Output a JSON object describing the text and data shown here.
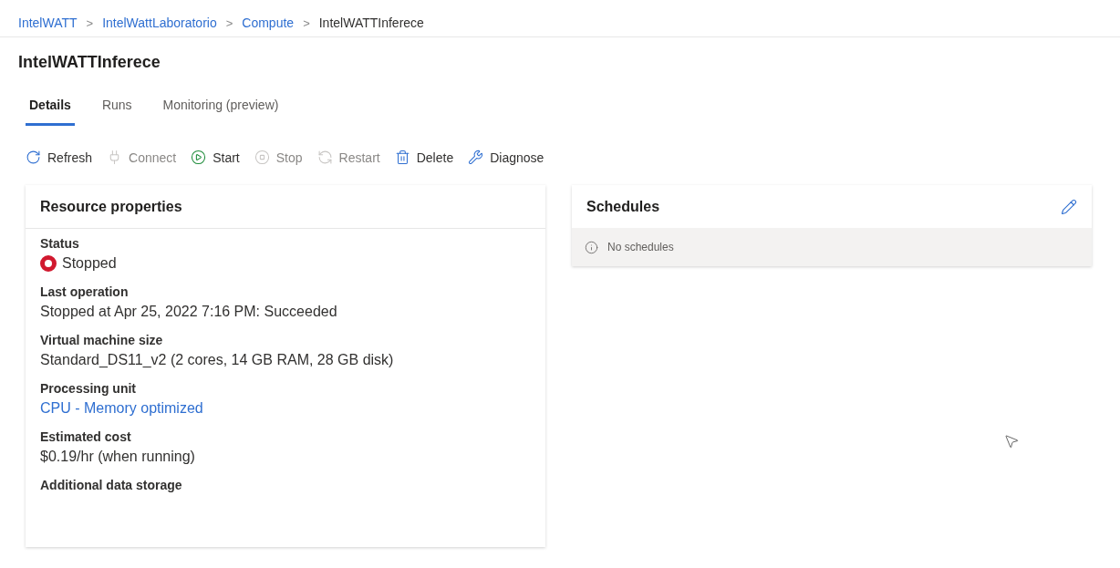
{
  "breadcrumb": [
    {
      "label": "IntelWATT",
      "link": true
    },
    {
      "label": "IntelWattLaboratorio",
      "link": true
    },
    {
      "label": "Compute",
      "link": true
    },
    {
      "label": "IntelWATTInferece",
      "link": false
    }
  ],
  "breadcrumb_separator": ">",
  "title": "IntelWATTInferece",
  "tabs": [
    {
      "label": "Details",
      "selected": true
    },
    {
      "label": "Runs",
      "selected": false
    },
    {
      "label": "Monitoring (preview)",
      "selected": false
    }
  ],
  "toolbar": [
    {
      "kind": "refresh",
      "label": "Refresh",
      "disabled": false
    },
    {
      "kind": "connect",
      "label": "Connect",
      "disabled": true
    },
    {
      "kind": "start",
      "label": "Start",
      "disabled": false
    },
    {
      "kind": "stop",
      "label": "Stop",
      "disabled": true
    },
    {
      "kind": "restart",
      "label": "Restart",
      "disabled": true
    },
    {
      "kind": "delete",
      "label": "Delete",
      "disabled": false
    },
    {
      "kind": "diagnose",
      "label": "Diagnose",
      "disabled": false
    }
  ],
  "resource_properties": {
    "title": "Resource properties",
    "items": [
      {
        "label": "Status",
        "value": "Stopped",
        "kind": "status"
      },
      {
        "label": "Last operation",
        "value": "Stopped at Apr 25, 2022 7:16 PM: Succeeded",
        "kind": "text"
      },
      {
        "label": "Virtual machine size",
        "value": "Standard_DS11_v2 (2 cores, 14 GB RAM, 28 GB disk)",
        "kind": "text"
      },
      {
        "label": "Processing unit",
        "value": "CPU - Memory optimized",
        "kind": "link"
      },
      {
        "label": "Estimated cost",
        "value": "$0.19/hr (when running)",
        "kind": "text"
      },
      {
        "label": "Additional data storage"
      }
    ]
  },
  "schedules": {
    "title": "Schedules",
    "message": "No schedules"
  }
}
